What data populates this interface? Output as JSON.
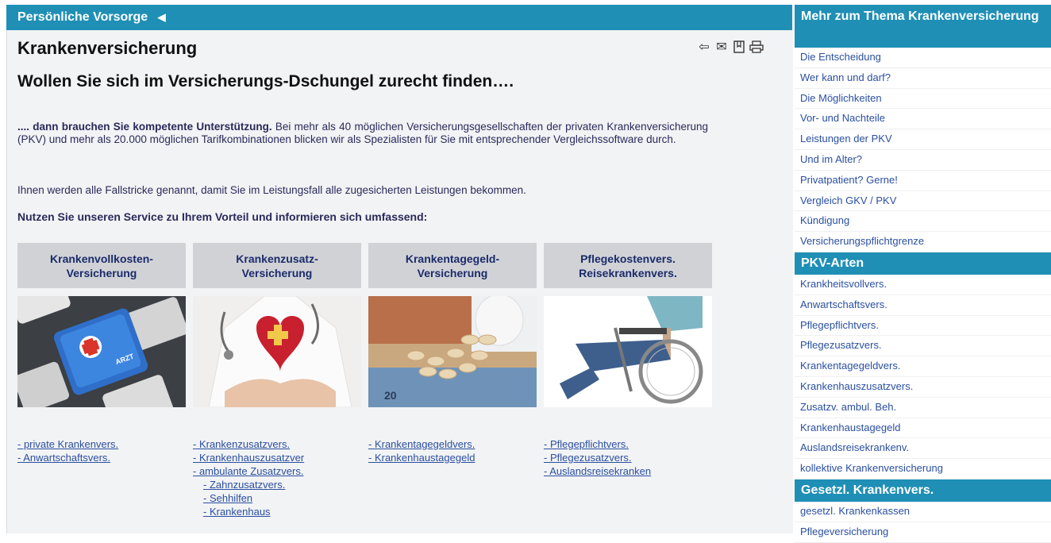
{
  "breadcrumb": {
    "label": "Persönliche Vorsorge"
  },
  "page": {
    "title": "Krankenversicherung",
    "headline": "Wollen Sie sich im Versicherungs-Dschungel zurecht finden….",
    "intro_bold": ".... dann brauchen Sie kompetente Unterstützung.",
    "intro_rest": " Bei mehr als 40 möglichen Versicherungsgesellschaften der privaten Krankenversicherung (PKV) und mehr als 20.000 möglichen Tarifkombinationen blicken wir als Spezialisten für Sie mit entsprechender Vergleichssoftware durch.",
    "para2": "Ihnen werden alle Fallstricke genannt, damit Sie im Leistungsfall alle zugesicherten Leistungen bekommen.",
    "para3": "Nutzen Sie unseren Service zu Ihrem Vorteil und informieren sich umfassend:"
  },
  "toolbar": {
    "icons": [
      "back-arrow-icon",
      "email-icon",
      "bookmark-icon",
      "print-icon"
    ]
  },
  "columns": [
    {
      "head1": "Krankenvollkosten-",
      "head2": "Versicherung",
      "image": "keyboard-arzt-key",
      "links": [
        {
          "t": "- private Krankenvers.",
          "sub": false
        },
        {
          "t": "- Anwartschaftsvers.",
          "sub": false
        }
      ]
    },
    {
      "head1": "Krankenzusatz-",
      "head2": "Versicherung",
      "image": "doctor-with-heart",
      "links": [
        {
          "t": "- Krankenzusatzvers.",
          "sub": false
        },
        {
          "t": "- Krankenhauszusatzver",
          "sub": false
        },
        {
          "t": "- ambulante Zusatzvers.",
          "sub": false
        },
        {
          "t": "- Zahnzusatzvers.",
          "sub": true
        },
        {
          "t": "- Sehhilfen",
          "sub": true
        },
        {
          "t": "- Krankenhaus",
          "sub": true
        }
      ]
    },
    {
      "head1": "Krankentagegeld-",
      "head2": "Versicherung",
      "image": "pills-on-money",
      "links": [
        {
          "t": "- Krankentagegeldvers.",
          "sub": false
        },
        {
          "t": "- Krankenhaustagegeld",
          "sub": false
        }
      ]
    },
    {
      "head1": "Pflegekostenvers.",
      "head2": "Reisekrankenvers.",
      "image": "person-in-wheelchair",
      "links": [
        {
          "t": "- Pflegepflichtvers.",
          "sub": false
        },
        {
          "t": "- Pflegezusatzvers.",
          "sub": false
        },
        {
          "t": "- Auslandsreisekranken",
          "sub": false
        }
      ]
    }
  ],
  "sidebar": {
    "sections": [
      {
        "title": "Mehr zum Thema Krankenversicherung",
        "items": [
          "Die Entscheidung",
          "Wer kann und darf?",
          "Die Möglichkeiten",
          "Vor- und Nachteile",
          "Leistungen der PKV",
          "Und im Alter?",
          "Privatpatient? Gerne!",
          "Vergleich GKV / PKV",
          "Kündigung",
          "Versicherungspflichtgrenze"
        ]
      },
      {
        "title": "PKV-Arten",
        "items": [
          "Krankheitsvollvers.",
          "Anwartschaftsvers.",
          "Pflegepflichtvers.",
          "Pflegezusatzvers.",
          "Krankentagegeldvers.",
          "Krankenhauszusatzvers.",
          "Zusatzv. ambul. Beh.",
          "Krankenhaustagegeld",
          "Auslandsreisekrankenv.",
          "kollektive Krankenversicherung"
        ]
      },
      {
        "title": "Gesetzl. Krankenvers.",
        "items": [
          "gesetzl. Krankenkassen",
          "Pflegeversicherung"
        ]
      }
    ]
  },
  "colors": {
    "accent": "#1f8fb5",
    "link": "#2a4fa0",
    "panel": "#f2f3f5",
    "col_header": "#d0d2d6"
  }
}
